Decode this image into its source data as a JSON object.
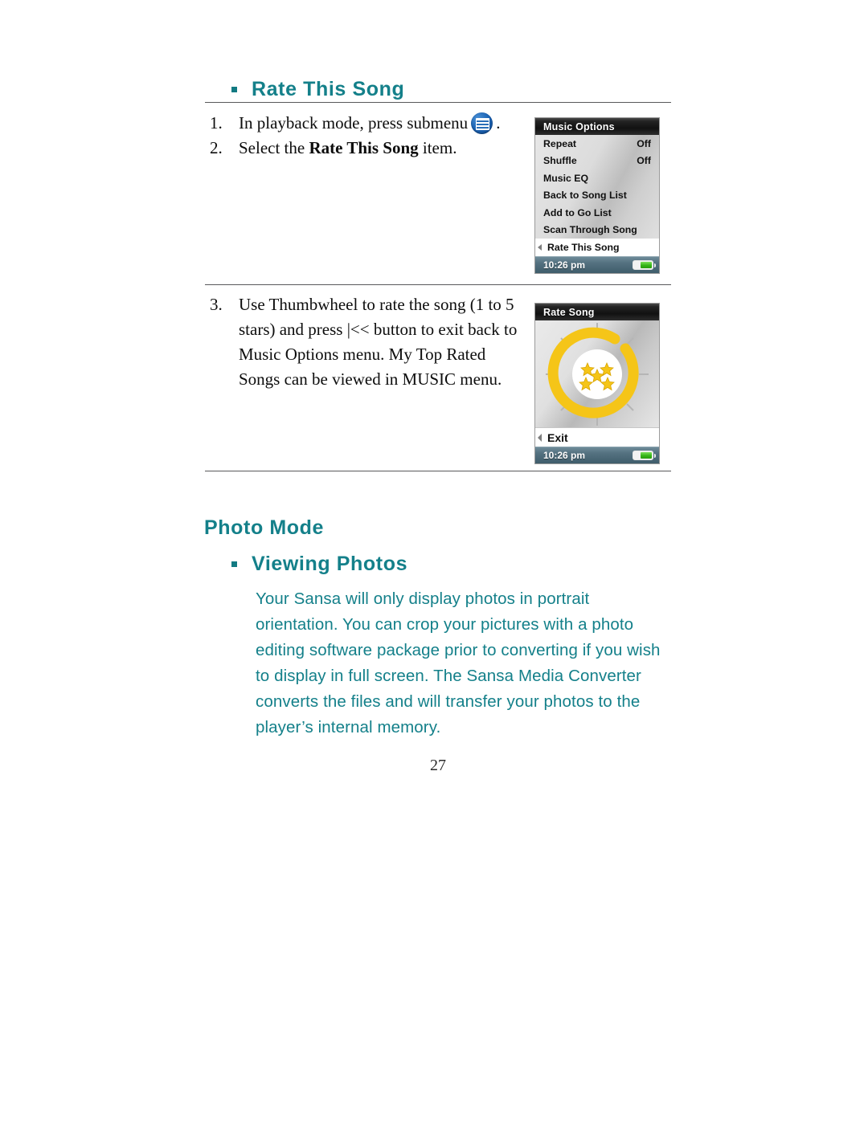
{
  "document": {
    "page_number": "27",
    "accent_color": "#14808a",
    "heading_rate_this_song": "Rate This Song",
    "heading_photo_mode": "Photo Mode",
    "heading_viewing_photos": "Viewing Photos"
  },
  "steps": [
    {
      "number": "1.",
      "text_before": "In playback mode, press submenu",
      "icon": "submenu-icon",
      "text_after": "."
    },
    {
      "number": "2.",
      "text_before": "Select the ",
      "bold": "Rate This Song",
      "text_after": " item."
    },
    {
      "number": "3.",
      "text": "Use Thumbwheel to rate the song (1 to 5 stars) and press |<< button to exit back to Music Options menu. My Top Rated Songs can be viewed in MUSIC menu."
    }
  ],
  "photo_mode": {
    "paragraph": "Your Sansa will only display photos in portrait orientation. You can crop your pictures with a photo editing software package prior to converting if you wish to display in full screen. The Sansa Media Converter converts the files and will transfer your photos to the player’s internal memory."
  },
  "device_music_options": {
    "title": "Music Options",
    "rows": [
      {
        "label": "Repeat",
        "value": "Off",
        "selected": false
      },
      {
        "label": "Shuffle",
        "value": "Off",
        "selected": false
      },
      {
        "label": "Music EQ",
        "value": "",
        "selected": false
      },
      {
        "label": "Back to Song List",
        "value": "",
        "selected": false
      },
      {
        "label": "Add to Go List",
        "value": "",
        "selected": false
      },
      {
        "label": "Scan Through Song",
        "value": "",
        "selected": false
      },
      {
        "label": "Rate This Song",
        "value": "",
        "selected": true
      }
    ],
    "status_time": "10:26 pm",
    "battery_icon": "battery-icon"
  },
  "device_rate_song": {
    "title": "Rate Song",
    "stars_shown": 5,
    "wheel_color": "#f5c518",
    "exit_label": "Exit",
    "status_time": "10:26 pm",
    "battery_icon": "battery-icon"
  }
}
